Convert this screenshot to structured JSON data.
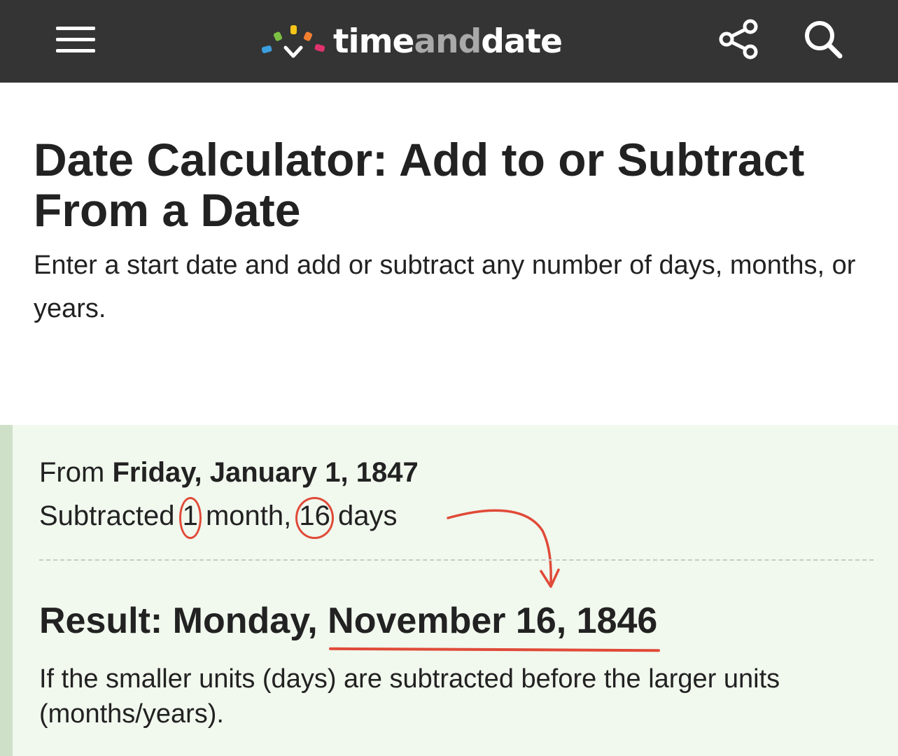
{
  "app": {
    "title": "timeanddate"
  },
  "header": {
    "logo_part1": "time",
    "logo_part2": "and",
    "logo_part3": "date",
    "icons": {
      "menu": "hamburger-menu-icon",
      "share": "share-icon",
      "search": "search-icon"
    },
    "logo_colors": [
      "#3b9fe0",
      "#7bc043",
      "#f5c518",
      "#f07f2f",
      "#e0336b"
    ]
  },
  "page": {
    "title": "Date Calculator: Add to or Subtract From a Date",
    "description": "Enter a start date and add or subtract any number of days, months, or years."
  },
  "result": {
    "from_prefix": "From",
    "from_date": "Friday, January 1, 1847",
    "subtracted_prefix": "Subtracted",
    "months_value": "1",
    "months_unit": "month,",
    "days_value": "16",
    "days_unit": "days",
    "result_prefix": "Result: Monday,",
    "result_date": "November 16, 1846",
    "note": "If the smaller units (days) are subtracted before the larger units (months/years)."
  },
  "colors": {
    "header_bg": "#343434",
    "annotation": "#e04a38",
    "result_bg": "#f1f8ee",
    "result_border": "#cfe0c9"
  }
}
